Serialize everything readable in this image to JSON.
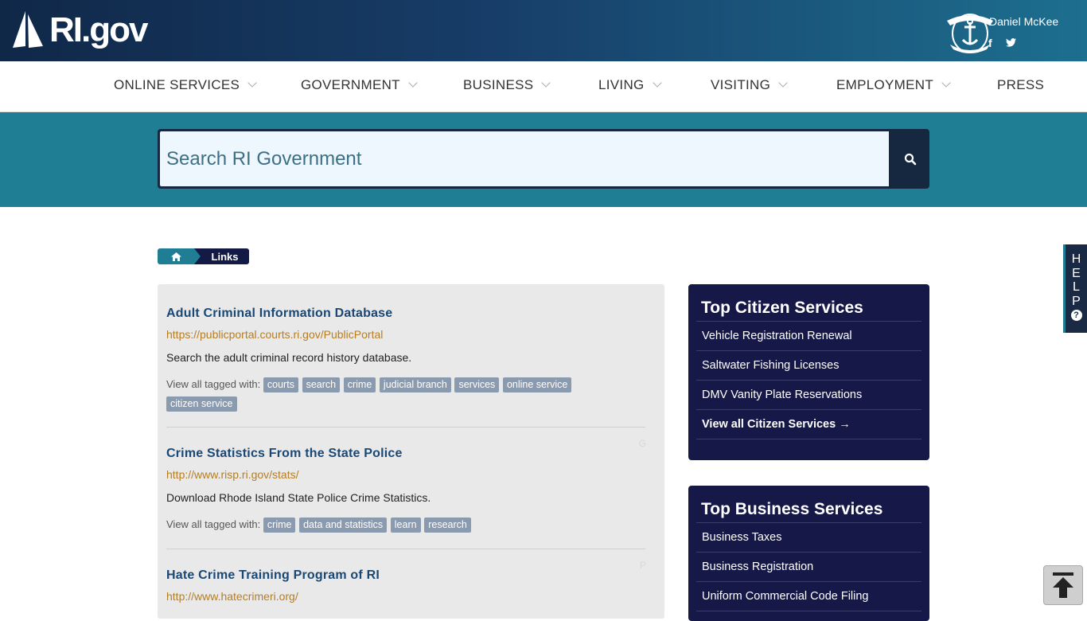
{
  "header": {
    "logo_text": "RI.gov",
    "governor_name": "Daniel McKee",
    "facebook_glyph": "f",
    "twitter_icon": "twitter-icon"
  },
  "nav": {
    "items": [
      {
        "label": "ONLINE SERVICES",
        "dropdown": true
      },
      {
        "label": "GOVERNMENT",
        "dropdown": true
      },
      {
        "label": "BUSINESS",
        "dropdown": true
      },
      {
        "label": "LIVING",
        "dropdown": true
      },
      {
        "label": "VISITING",
        "dropdown": true
      },
      {
        "label": "EMPLOYMENT",
        "dropdown": true
      },
      {
        "label": "PRESS",
        "dropdown": false
      }
    ]
  },
  "search": {
    "placeholder": "Search RI Government",
    "value": ""
  },
  "breadcrumb": {
    "current": "Links"
  },
  "results": [
    {
      "title": "Adult Criminal Information Database",
      "url": "https://publicportal.courts.ri.gov/PublicPortal",
      "description": "Search the adult criminal record history database.",
      "tags_label": "View all tagged with:",
      "tags": [
        "courts",
        "search",
        "crime",
        "judicial branch",
        "services",
        "online service",
        "citizen service"
      ]
    },
    {
      "title": "Crime Statistics From the State Police",
      "url": "http://www.risp.ri.gov/stats/",
      "description": "Download Rhode Island State Police Crime Statistics.",
      "tags_label": "View all tagged with:",
      "tags": [
        "crime",
        "data and statistics",
        "learn",
        "research"
      ],
      "letter": "G"
    },
    {
      "title": "Hate Crime Training Program of RI",
      "url": "http://www.hatecrimeri.org/",
      "letter": "P"
    }
  ],
  "citizen_services": {
    "title": "Top Citizen Services",
    "items": [
      "Vehicle Registration Renewal",
      "Saltwater Fishing Licenses",
      "DMV Vanity Plate Reservations"
    ],
    "view_all": "View all Citizen Services →"
  },
  "business_services": {
    "title": "Top Business Services",
    "items": [
      "Business Taxes",
      "Business Registration",
      "Uniform Commercial Code Filing"
    ]
  },
  "help_tab": {
    "letters": [
      "H",
      "E",
      "L",
      "P"
    ],
    "icon": "question-icon"
  },
  "colors": {
    "header_dark": "#102848",
    "header_teal": "#1d6f8f",
    "search_band": "#1f7d94",
    "sidebox": "#161847",
    "link_title": "#1a4875",
    "link_url": "#b47e24",
    "tag_bg": "#8a9bb0"
  }
}
